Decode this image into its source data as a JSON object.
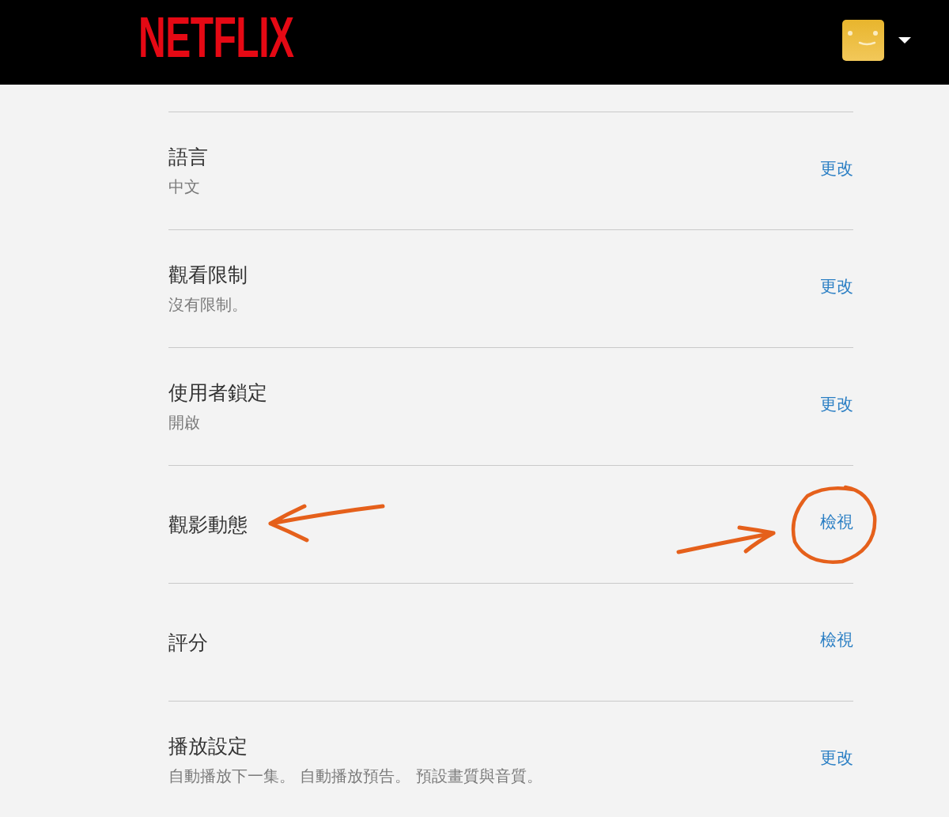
{
  "header": {
    "logo": "NETFLIX"
  },
  "rows": [
    {
      "title": "語言",
      "value": "中文",
      "action": "更改",
      "highlighted": false
    },
    {
      "title": "觀看限制",
      "value": "沒有限制。",
      "action": "更改",
      "highlighted": false
    },
    {
      "title": "使用者鎖定",
      "value": "開啟",
      "action": "更改",
      "highlighted": false
    },
    {
      "title": "觀影動態",
      "action": "檢視",
      "highlighted": true
    },
    {
      "title": "評分",
      "action": "檢視",
      "highlighted": false
    },
    {
      "title": "播放設定",
      "value": "自動播放下一集。 自動播放預告。 預設畫質與音質。",
      "action": "更改",
      "highlighted": false
    }
  ]
}
